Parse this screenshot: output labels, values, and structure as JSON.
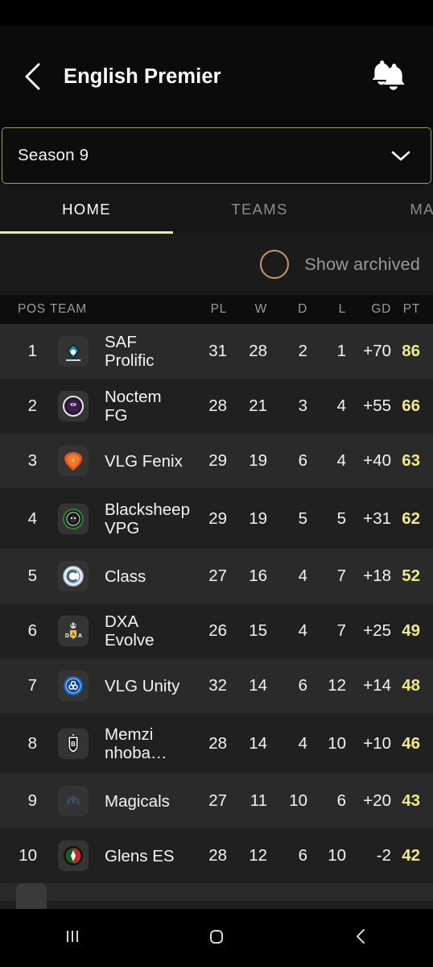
{
  "statusbar": {
    "name": "status-bar"
  },
  "appbar": {
    "back_icon": "chevron-left-icon",
    "title": "English Premier",
    "notifications_icon": "bells-icon"
  },
  "season": {
    "label": "Season 9",
    "chevron_icon": "chevron-down-icon",
    "border_color": "#9a9a5e"
  },
  "tabs": {
    "items": [
      {
        "label": "HOME",
        "active": true
      },
      {
        "label": "TEAMS",
        "active": false
      },
      {
        "label": "MATC",
        "active": false
      }
    ],
    "indicator_color": "#eeeb95"
  },
  "archived": {
    "label": "Show archived",
    "checked": false,
    "circle_color": "#c89a6a"
  },
  "table": {
    "columns": [
      "POS",
      "TEAM",
      "PL",
      "W",
      "D",
      "L",
      "GD",
      "PT"
    ],
    "points_color": "#eeeb88",
    "rows": [
      {
        "pos": "1",
        "team": "SAF Prolific",
        "logo": "saf-prolific-logo",
        "pl": "31",
        "w": "28",
        "d": "2",
        "l": "1",
        "gd": "+70",
        "pt": "86"
      },
      {
        "pos": "2",
        "team": "Noctem FG",
        "logo": "noctem-fg-logo",
        "pl": "28",
        "w": "21",
        "d": "3",
        "l": "4",
        "gd": "+55",
        "pt": "66"
      },
      {
        "pos": "3",
        "team": "VLG Fenix",
        "logo": "vlg-fenix-logo",
        "pl": "29",
        "w": "19",
        "d": "6",
        "l": "4",
        "gd": "+40",
        "pt": "63"
      },
      {
        "pos": "4",
        "team": "Blacksheep VPG",
        "logo": "blacksheep-vpg-logo",
        "pl": "29",
        "w": "19",
        "d": "5",
        "l": "5",
        "gd": "+31",
        "pt": "62"
      },
      {
        "pos": "5",
        "team": "Class",
        "logo": "class-logo",
        "pl": "27",
        "w": "16",
        "d": "4",
        "l": "7",
        "gd": "+18",
        "pt": "52"
      },
      {
        "pos": "6",
        "team": "DXA Evolve",
        "logo": "dxa-evolve-logo",
        "pl": "26",
        "w": "15",
        "d": "4",
        "l": "7",
        "gd": "+25",
        "pt": "49"
      },
      {
        "pos": "7",
        "team": "VLG Unity",
        "logo": "vlg-unity-logo",
        "pl": "32",
        "w": "14",
        "d": "6",
        "l": "12",
        "gd": "+14",
        "pt": "48"
      },
      {
        "pos": "8",
        "team": "Memzi nhoba…",
        "logo": "memzi-logo",
        "pl": "28",
        "w": "14",
        "d": "4",
        "l": "10",
        "gd": "+10",
        "pt": "46"
      },
      {
        "pos": "9",
        "team": "Magicals",
        "logo": "magicals-logo",
        "pl": "27",
        "w": "11",
        "d": "10",
        "l": "6",
        "gd": "+20",
        "pt": "43"
      },
      {
        "pos": "10",
        "team": "Glens ES",
        "logo": "glens-es-logo",
        "pl": "28",
        "w": "12",
        "d": "6",
        "l": "10",
        "gd": "-2",
        "pt": "42"
      }
    ]
  },
  "navbar": {
    "recents_icon": "recents-icon",
    "home_icon": "home-icon",
    "back_icon": "back-icon"
  }
}
